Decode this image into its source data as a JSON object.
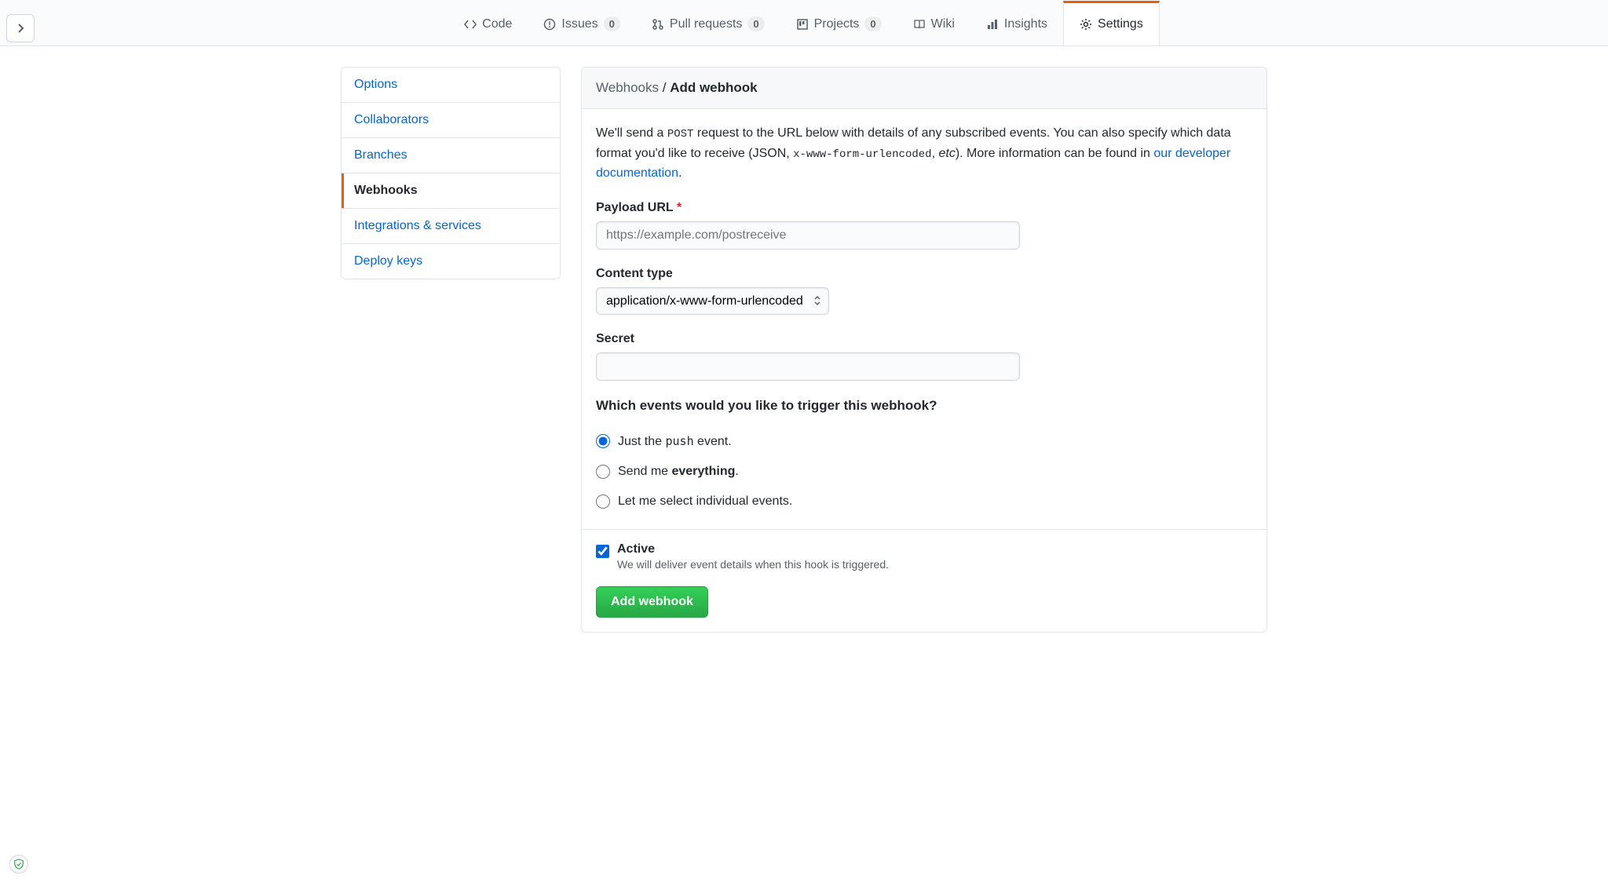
{
  "tabs": {
    "code": "Code",
    "issues": "Issues",
    "issues_count": "0",
    "pulls": "Pull requests",
    "pulls_count": "0",
    "projects": "Projects",
    "projects_count": "0",
    "wiki": "Wiki",
    "insights": "Insights",
    "settings": "Settings"
  },
  "sidebar": {
    "options": "Options",
    "collaborators": "Collaborators",
    "branches": "Branches",
    "webhooks": "Webhooks",
    "integrations": "Integrations & services",
    "deploy_keys": "Deploy keys"
  },
  "header": {
    "breadcrumb_parent": "Webhooks",
    "separator": " / ",
    "breadcrumb_current": "Add webhook"
  },
  "description": {
    "part1": "We'll send a ",
    "code1": "POST",
    "part2": " request to the URL below with details of any subscribed events. You can also specify which data format you'd like to receive (JSON, ",
    "code2": "x-www-form-urlencoded",
    "part3": ", ",
    "em": "etc",
    "part4": "). More information can be found in ",
    "link": "our developer documentation",
    "part5": "."
  },
  "form": {
    "payload_label": "Payload URL",
    "payload_placeholder": "https://example.com/postreceive",
    "content_type_label": "Content type",
    "content_type_value": "application/x-www-form-urlencoded",
    "secret_label": "Secret",
    "events_heading": "Which events would you like to trigger this webhook?",
    "radio_push_1": "Just the ",
    "radio_push_code": "push",
    "radio_push_2": " event.",
    "radio_everything_1": "Send me ",
    "radio_everything_strong": "everything",
    "radio_everything_2": ".",
    "radio_individual": "Let me select individual events.",
    "active_label": "Active",
    "active_desc": "We will deliver event details when this hook is triggered.",
    "submit": "Add webhook"
  }
}
